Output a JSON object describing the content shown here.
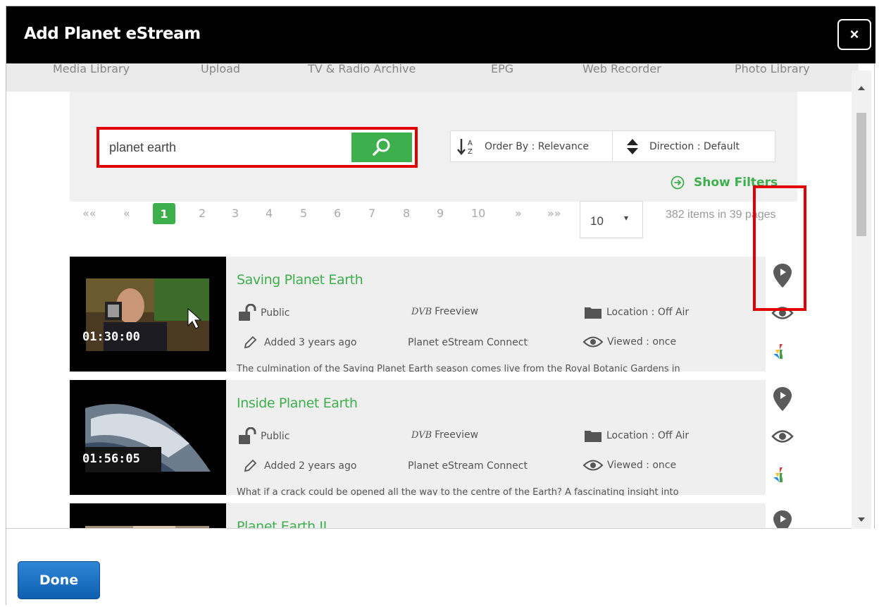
{
  "dialog": {
    "title": "Add Planet eStream",
    "close_label": "×",
    "done_label": "Done"
  },
  "tabs": [
    {
      "label": "Media Library"
    },
    {
      "label": "Upload"
    },
    {
      "label": "TV & Radio Archive"
    },
    {
      "label": "EPG"
    },
    {
      "label": "Web Recorder"
    },
    {
      "label": "Photo Library"
    }
  ],
  "search": {
    "value": "planet earth",
    "order_label": "Order By : Relevance",
    "direction_label": "Direction : Default",
    "show_filters_label": "Show Filters"
  },
  "pagination": {
    "first": "««",
    "prev": "«",
    "pages": [
      "1",
      "2",
      "3",
      "4",
      "5",
      "6",
      "7",
      "8",
      "9",
      "10"
    ],
    "active_page": "1",
    "next": "»",
    "last": "»»",
    "per_page": "10",
    "summary": "382 items in 39 pages"
  },
  "results": [
    {
      "title": "Saving Planet Earth",
      "duration": "01:30:00",
      "access": "Public",
      "channel_logo": "DVB",
      "channel": "Freeview",
      "location": "Location : Off Air",
      "added": "Added 3 years ago",
      "source": "Planet eStream Connect",
      "viewed": "Viewed : once",
      "description": "The culmination of the Saving Planet Earth season comes live from the Royal Botanic Gardens in"
    },
    {
      "title": "Inside Planet Earth",
      "duration": "01:56:05",
      "access": "Public",
      "channel_logo": "DVB",
      "channel": "Freeview",
      "location": "Location : Off Air",
      "added": "Added 2 years ago",
      "source": "Planet eStream Connect",
      "viewed": "Viewed : once",
      "description": "What if a crack could be opened all the way to the centre of the Earth? A fascinating insight into"
    },
    {
      "title": "Planet Earth II"
    }
  ],
  "colors": {
    "accent_green": "#3db04d",
    "highlight_red": "#e00000",
    "done_blue": "#1a6fc4"
  }
}
